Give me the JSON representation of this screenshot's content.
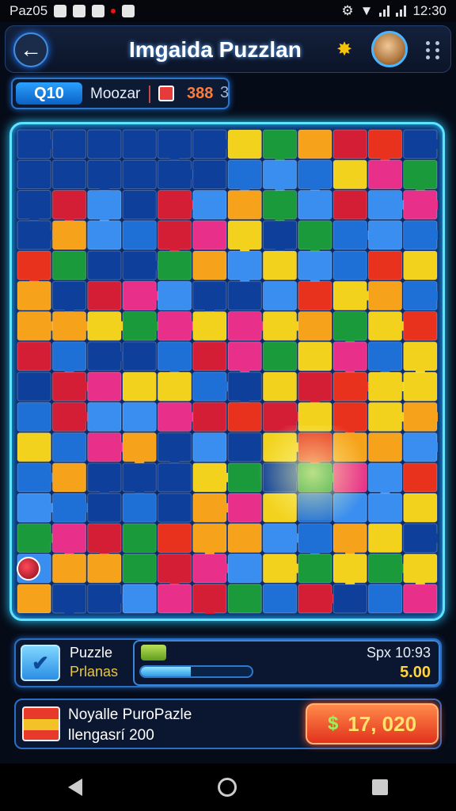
{
  "status_bar": {
    "left_text": "Paz05",
    "time": "12:30"
  },
  "header": {
    "title": "Imgaida Puzzlan",
    "icons": [
      "back-arrow-icon",
      "gear-icon",
      "avatar",
      "more-icon"
    ]
  },
  "info_pill": {
    "level": "Q10",
    "mode": "Moozar",
    "score": "388",
    "suffix": "3"
  },
  "board": {
    "cols": 12,
    "rows": 16,
    "palette": [
      "#0e3f9a",
      "#1e6fd6",
      "#3a8ef0",
      "#f2d21c",
      "#f6a21a",
      "#e8321e",
      "#d41e36",
      "#1a9a3a",
      "#e8308a"
    ]
  },
  "progress_panel": {
    "label_line1": "Puzzle",
    "label_line2": "Prlanas",
    "time": "Spx 10:93",
    "value": "5.00",
    "progress": 0.45
  },
  "reward_panel": {
    "title": "Noyalle PuroPazle",
    "subtitle": "llengasrí 200",
    "price": "17, 020"
  }
}
